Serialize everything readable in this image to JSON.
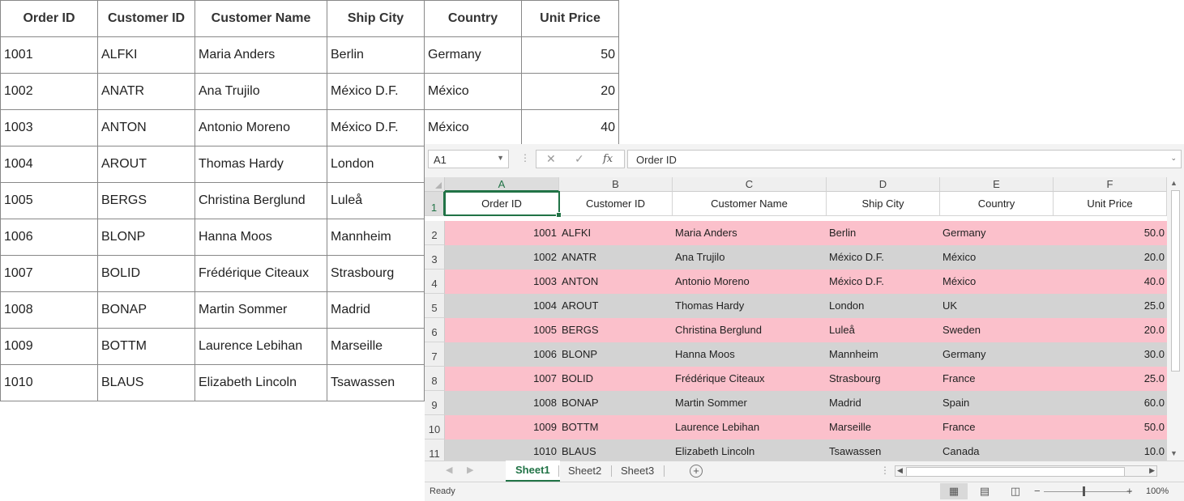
{
  "grid": {
    "columns": [
      "Order ID",
      "Customer ID",
      "Customer Name",
      "Ship City",
      "Country",
      "Unit Price"
    ],
    "rows": [
      [
        "1001",
        "ALFKI",
        "Maria Anders",
        "Berlin",
        "Germany",
        "50"
      ],
      [
        "1002",
        "ANATR",
        "Ana Trujilo",
        "México D.F.",
        "México",
        "20"
      ],
      [
        "1003",
        "ANTON",
        "Antonio Moreno",
        "México D.F.",
        "México",
        "40"
      ],
      [
        "1004",
        "AROUT",
        "Thomas Hardy",
        "London",
        "",
        ""
      ],
      [
        "1005",
        "BERGS",
        "Christina Berglund",
        "Luleå",
        "",
        ""
      ],
      [
        "1006",
        "BLONP",
        "Hanna Moos",
        "Mannheim",
        "",
        ""
      ],
      [
        "1007",
        "BOLID",
        "Frédérique Citeaux",
        "Strasbourg",
        "",
        ""
      ],
      [
        "1008",
        "BONAP",
        "Martin Sommer",
        "Madrid",
        "",
        ""
      ],
      [
        "1009",
        "BOTTM",
        "Laurence Lebihan",
        "Marseille",
        "",
        ""
      ],
      [
        "1010",
        "BLAUS",
        "Elizabeth Lincoln",
        "Tsawassen",
        "",
        ""
      ]
    ]
  },
  "spreadsheet": {
    "name_box": "A1",
    "formula_value": "Order ID",
    "icons": {
      "cancel": "cancel-icon",
      "confirm": "check-icon",
      "function": "fx-icon"
    },
    "column_letters": [
      "A",
      "B",
      "C",
      "D",
      "E",
      "F"
    ],
    "header_row": [
      "Order ID",
      "Customer ID",
      "Customer Name",
      "Ship City",
      "Country",
      "Unit Price"
    ],
    "row_numbers": [
      "1",
      "2",
      "3",
      "4",
      "5",
      "6",
      "7",
      "8",
      "9",
      "10",
      "11"
    ],
    "rows": [
      [
        "1001",
        "ALFKI",
        "Maria Anders",
        "Berlin",
        "Germany",
        "50.0"
      ],
      [
        "1002",
        "ANATR",
        "Ana Trujilo",
        "México D.F.",
        "México",
        "20.0"
      ],
      [
        "1003",
        "ANTON",
        "Antonio Moreno",
        "México D.F.",
        "México",
        "40.0"
      ],
      [
        "1004",
        "AROUT",
        "Thomas Hardy",
        "London",
        "UK",
        "25.0"
      ],
      [
        "1005",
        "BERGS",
        "Christina Berglund",
        "Luleå",
        "Sweden",
        "20.0"
      ],
      [
        "1006",
        "BLONP",
        "Hanna Moos",
        "Mannheim",
        "Germany",
        "30.0"
      ],
      [
        "1007",
        "BOLID",
        "Frédérique Citeaux",
        "Strasbourg",
        "France",
        "25.0"
      ],
      [
        "1008",
        "BONAP",
        "Martin Sommer",
        "Madrid",
        "Spain",
        "60.0"
      ],
      [
        "1009",
        "BOTTM",
        "Laurence Lebihan",
        "Marseille",
        "France",
        "50.0"
      ],
      [
        "1010",
        "BLAUS",
        "Elizabeth Lincoln",
        "Tsawassen",
        "Canada",
        "10.0"
      ]
    ],
    "sheets": [
      "Sheet1",
      "Sheet2",
      "Sheet3"
    ],
    "active_sheet": "Sheet1",
    "status": "Ready",
    "zoom": "100%",
    "colors": {
      "accent": "#217346",
      "row_pink": "#fbc0cb",
      "row_gray": "#d3d3d3"
    }
  }
}
